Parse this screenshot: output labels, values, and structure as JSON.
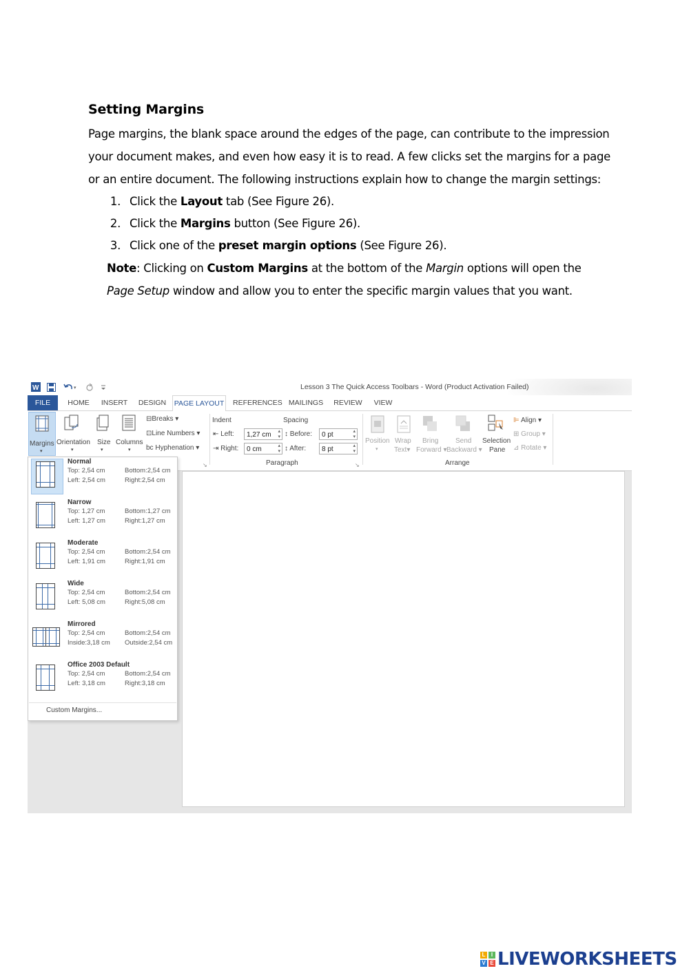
{
  "document": {
    "heading": "Setting Margins",
    "intro": "Page margins, the blank space around the edges of the page, can contribute to the impression your document makes, and even how easy it is to read. A few clicks set the margins for a page or an entire document. The following instructions explain how to change the margin settings:",
    "steps": [
      {
        "pre": "Click the ",
        "bold": "Layout",
        "post": " tab (See Figure 26)."
      },
      {
        "pre": "Click the ",
        "bold": "Margins",
        "post": " button (See Figure 26)."
      },
      {
        "pre": "Click one of the ",
        "bold": "preset margin options",
        "post": " (See Figure 26)."
      }
    ],
    "note": {
      "label": "Note",
      "t1": ": Clicking on ",
      "b1": "Custom Margins",
      "t2": " at the bottom of the ",
      "i1": "Margin",
      "t3": " options will open the ",
      "i2": "Page Setup",
      "t4": " window and allow you to enter the specific margin values that you want."
    }
  },
  "word": {
    "title": "Lesson 3  The  Quick Access Toolbars - Word (Product Activation Failed)",
    "tabs": [
      "FILE",
      "HOME",
      "INSERT",
      "DESIGN",
      "PAGE LAYOUT",
      "REFERENCES",
      "MAILINGS",
      "REVIEW",
      "VIEW"
    ],
    "ribbon": {
      "margins": "Margins",
      "orientation": "Orientation",
      "size": "Size",
      "columns": "Columns",
      "breaks": "Breaks",
      "line_numbers": "Line Numbers",
      "hyphenation": "Hyphenation",
      "indent": "Indent",
      "spacing": "Spacing",
      "left_label": "Left:",
      "right_label": "Right:",
      "before_label": "Before:",
      "after_label": "After:",
      "left_value": "1,27 cm",
      "right_value": "0 cm",
      "before_value": "0 pt",
      "after_value": "8 pt",
      "paragraph_group": "Paragraph",
      "arrange_group": "Arrange",
      "position": "Position",
      "wrap": "Wrap",
      "text": "Text",
      "bring": "Bring",
      "forward": "Forward",
      "send": "Send",
      "backward": "Backward",
      "selection": "Selection",
      "pane": "Pane",
      "align": "Align",
      "group": "Group",
      "rotate": "Rotate"
    },
    "margin_options": [
      {
        "name": "Normal",
        "r1a": "Top:  2,54 cm",
        "r1b": "Bottom:2,54 cm",
        "r2a": "Left:  2,54 cm",
        "r2b": "Right:2,54 cm"
      },
      {
        "name": "Narrow",
        "r1a": "Top:  1,27 cm",
        "r1b": "Bottom:1,27 cm",
        "r2a": "Left:  1,27 cm",
        "r2b": "Right:1,27 cm"
      },
      {
        "name": "Moderate",
        "r1a": "Top:  2,54 cm",
        "r1b": "Bottom:2,54 cm",
        "r2a": "Left:  1,91 cm",
        "r2b": "Right:1,91 cm"
      },
      {
        "name": "Wide",
        "r1a": "Top:  2,54 cm",
        "r1b": "Bottom:2,54 cm",
        "r2a": "Left:  5,08 cm",
        "r2b": "Right:5,08 cm"
      },
      {
        "name": "Mirrored",
        "r1a": "Top:  2,54 cm",
        "r1b": "Bottom:2,54 cm",
        "r2a": "Inside:3,18 cm",
        "r2b": "Outside:2,54 cm"
      },
      {
        "name": "Office 2003 Default",
        "r1a": "Top:  2,54 cm",
        "r1b": "Bottom:2,54 cm",
        "r2a": "Left:  3,18 cm",
        "r2b": "Right:3,18 cm"
      }
    ],
    "custom_margins": "Custom Margins..."
  },
  "footer": {
    "logo_text": "LIVEWORKSHEETS",
    "logo_letters": [
      "L",
      "I",
      "V",
      "E"
    ]
  },
  "colors": {
    "word_blue": "#2b579a",
    "logo_blue": "#1b3f8f",
    "logo_squares": [
      "#f2a900",
      "#5cb85c",
      "#2b7bd1",
      "#e94b3c"
    ]
  }
}
